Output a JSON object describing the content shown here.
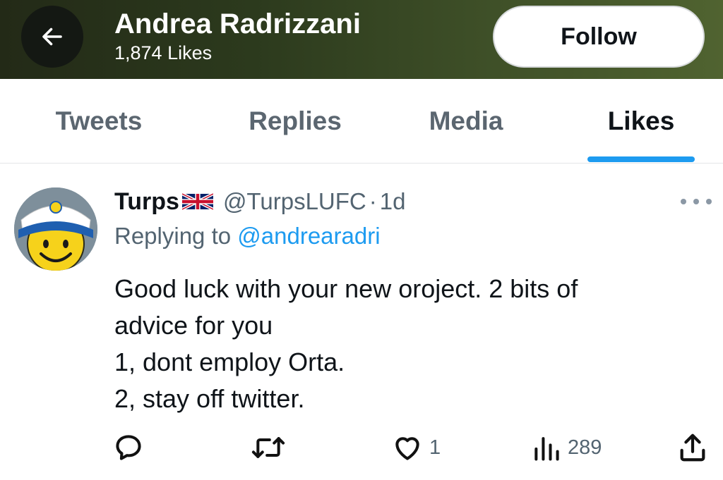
{
  "header": {
    "name": "Andrea Radrizzani",
    "likes_count": "1,874 Likes",
    "follow_label": "Follow",
    "banner_color": "#2c3a1d"
  },
  "tabs": [
    {
      "label": "Tweets",
      "active": false
    },
    {
      "label": "Replies",
      "active": false
    },
    {
      "label": "Media",
      "active": false
    },
    {
      "label": "Likes",
      "active": true
    }
  ],
  "tweet": {
    "author_name": "Turps",
    "flag_icon": "uk-flag-icon",
    "handle": "@TurpsLUFC",
    "separator": "·",
    "time": "1d",
    "replying_prefix": "Replying to",
    "replying_to": "@andrearadri",
    "text_lines": [
      "Good luck with your new oroject. 2 bits of",
      "advice for you",
      "1, dont employ Orta.",
      "2, stay off twitter."
    ],
    "actions": {
      "reply": {
        "icon": "reply-icon",
        "count": ""
      },
      "retweet": {
        "icon": "retweet-icon",
        "count": ""
      },
      "like": {
        "icon": "heart-icon",
        "count": "1"
      },
      "views": {
        "icon": "views-icon",
        "count": "289"
      },
      "share": {
        "icon": "share-icon",
        "count": ""
      }
    }
  },
  "colors": {
    "accent": "#1d9bf0",
    "text_primary": "#0f1419",
    "text_secondary": "#536471"
  }
}
